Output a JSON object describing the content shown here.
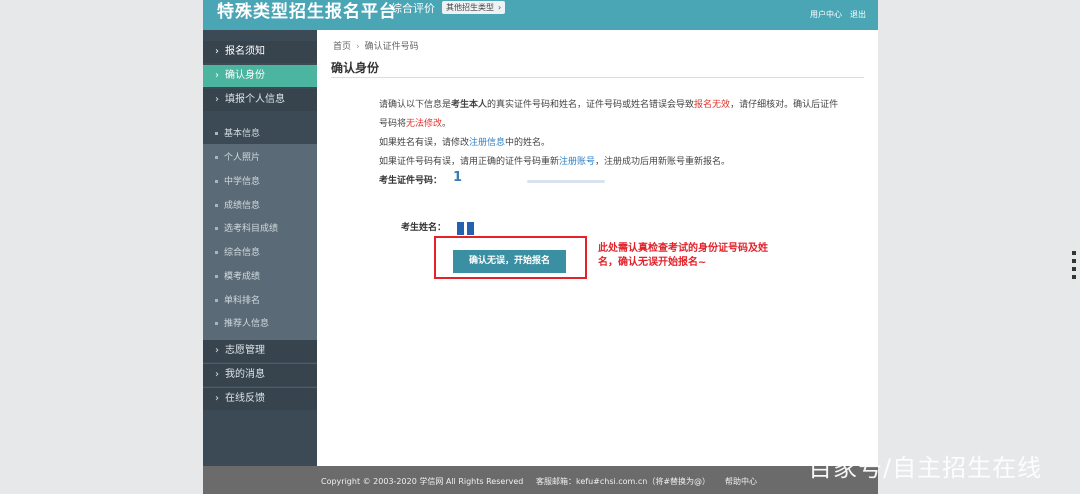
{
  "header": {
    "brand": "特殊类型招生报名平台",
    "module": "综合评价",
    "switch_label": "其他招生类型",
    "user_center": "用户中心",
    "logout": "退出"
  },
  "sidebar": {
    "top_items": [
      {
        "label": "报名须知"
      },
      {
        "label": "确认身份"
      },
      {
        "label": "填报个人信息"
      }
    ],
    "sub_items": [
      "基本信息",
      "个人照片",
      "中学信息",
      "成绩信息",
      "选考科目成绩",
      "综合信息",
      "模考成绩",
      "单科排名",
      "推荐人信息"
    ],
    "bottom_items": [
      {
        "label": "志愿管理"
      },
      {
        "label": "我的消息"
      },
      {
        "label": "在线反馈"
      }
    ]
  },
  "main": {
    "breadcrumb": {
      "home": "首页",
      "current": "确认证件号码"
    },
    "title": "确认身份",
    "notice": {
      "p1_a": "请确认以下信息是",
      "p1_bold": "考生本人",
      "p1_b": "的真实证件号码和姓名，证件号码或姓名错误会导致",
      "p1_red1": "报名无效",
      "p1_c": "，请仔细核对。确认后证件号码将",
      "p1_red2": "无法修改",
      "p1_d": "。",
      "p2_a": "如果姓名有误，请修改",
      "p2_link": "注册信息",
      "p2_b": "中的姓名。",
      "p3_a": "如果证件号码有误，请用正确的证件号码重新",
      "p3_link": "注册账号",
      "p3_b": "，注册成功后用新账号重新报名。"
    },
    "id_label": "考生证件号码：",
    "id_value": "1",
    "name_label": "考生姓名：",
    "confirm_button": "确认无误，开始报名",
    "callout": "此处需认真检查考试的身份证号码及姓名，确认无误开始报名~"
  },
  "footer": {
    "copyright": "Copyright © 2003-2020 学信网 All Rights Reserved",
    "email": "客服邮箱：kefu#chsi.com.cn（将#替换为@）",
    "help": "帮助中心"
  },
  "watermark": "百家号/自主招生在线",
  "colors": {
    "header": "#4aa5b5",
    "active_nav": "#4cb5a0",
    "sidebar": "#3c4a55",
    "button": "#3a8fa3",
    "alert": "#e3222a"
  }
}
